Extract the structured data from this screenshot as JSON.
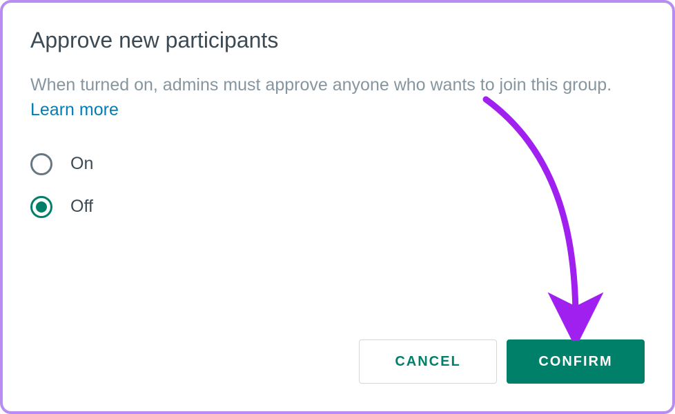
{
  "dialog": {
    "title": "Approve new participants",
    "description_text": "When turned on, admins must approve anyone who wants to join this group. ",
    "learn_more_label": "Learn more",
    "options": {
      "on_label": "On",
      "off_label": "Off",
      "selected": "off"
    },
    "buttons": {
      "cancel_label": "CANCEL",
      "confirm_label": "CONFIRM"
    }
  },
  "colors": {
    "accent": "#008069",
    "border": "#b98cf2",
    "arrow": "#a020f0"
  }
}
